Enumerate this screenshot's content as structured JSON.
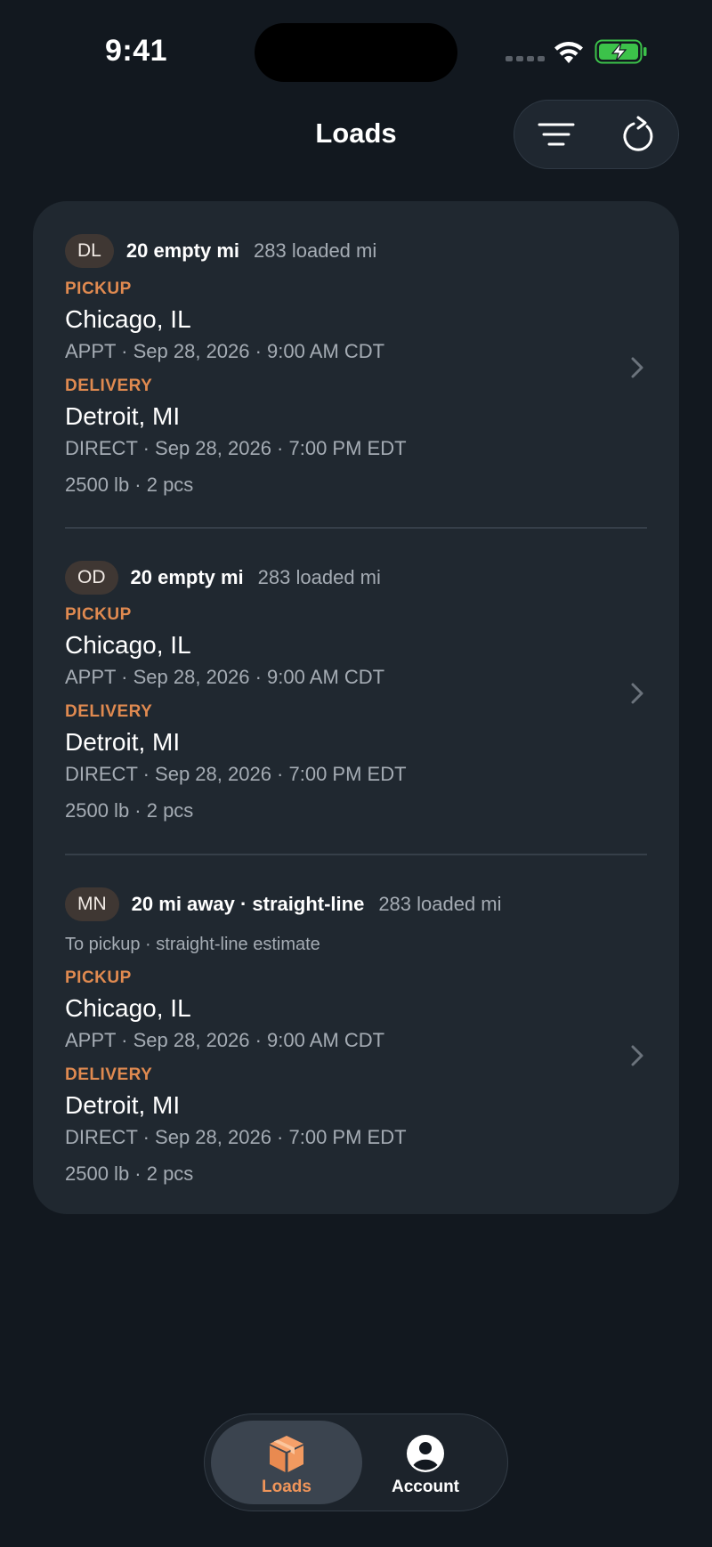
{
  "status_bar": {
    "time": "9:41"
  },
  "header": {
    "title": "Loads",
    "actions": [
      {
        "name": "filter",
        "icon": "filter-icon"
      },
      {
        "name": "refresh",
        "icon": "refresh-icon"
      }
    ]
  },
  "colors": {
    "background": "#12181f",
    "card": "#202830",
    "accent": "#e08a50",
    "battery": "#3cc24a"
  },
  "loads": [
    {
      "badge": "DL",
      "primary": "20 empty mi",
      "secondary": "283 loaded mi",
      "note": "",
      "pickup_label": "PICKUP",
      "pickup_city": "Chicago, IL",
      "pickup_detail": "APPT · Sep 28, 2026 · 9:00 AM CDT",
      "delivery_label": "DELIVERY",
      "delivery_city": "Detroit, MI",
      "delivery_detail": "DIRECT · Sep 28, 2026 · 7:00 PM EDT",
      "weight": "2500 lb · 2 pcs"
    },
    {
      "badge": "OD",
      "primary": "20 empty mi",
      "secondary": "283 loaded mi",
      "note": "",
      "pickup_label": "PICKUP",
      "pickup_city": "Chicago, IL",
      "pickup_detail": "APPT · Sep 28, 2026 · 9:00 AM CDT",
      "delivery_label": "DELIVERY",
      "delivery_city": "Detroit, MI",
      "delivery_detail": "DIRECT · Sep 28, 2026 · 7:00 PM EDT",
      "weight": "2500 lb · 2 pcs"
    },
    {
      "badge": "MN",
      "primary": "20 mi away · straight-line",
      "secondary": "283 loaded mi",
      "note": "To pickup · straight-line estimate",
      "pickup_label": "PICKUP",
      "pickup_city": "Chicago, IL",
      "pickup_detail": "APPT · Sep 28, 2026 · 9:00 AM CDT",
      "delivery_label": "DELIVERY",
      "delivery_city": "Detroit, MI",
      "delivery_detail": "DIRECT · Sep 28, 2026 · 7:00 PM EDT",
      "weight": "2500 lb · 2 pcs"
    }
  ],
  "tab_bar": {
    "tabs": [
      {
        "label": "Loads",
        "icon": "package-icon",
        "selected": true
      },
      {
        "label": "Account",
        "icon": "account-icon",
        "selected": false
      }
    ]
  }
}
